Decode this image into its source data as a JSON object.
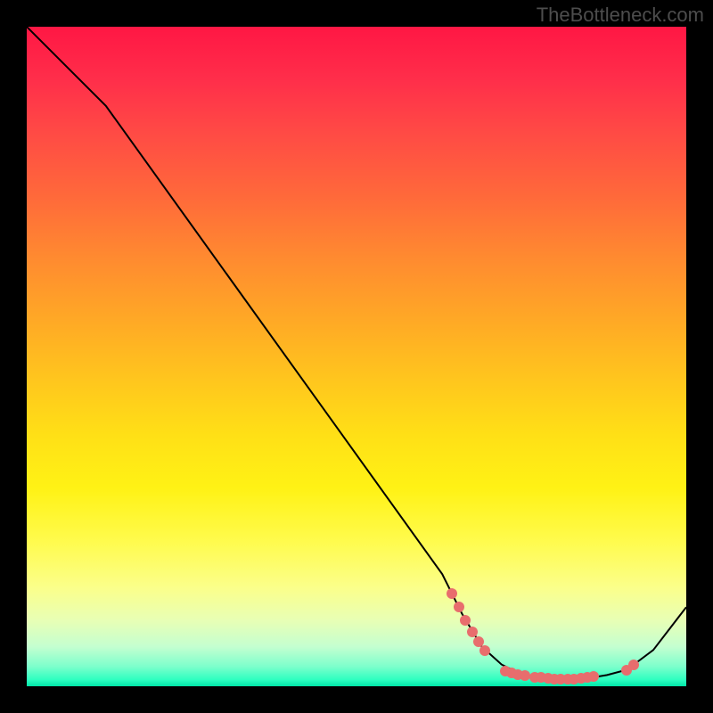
{
  "attribution": "TheBottleneck.com",
  "chart_data": {
    "type": "line",
    "title": "",
    "xlabel": "",
    "ylabel": "",
    "xlim": [
      0,
      100
    ],
    "ylim": [
      0,
      100
    ],
    "curve_points": [
      {
        "x": 0,
        "y": 100
      },
      {
        "x": 7,
        "y": 93
      },
      {
        "x": 12,
        "y": 88
      },
      {
        "x": 63,
        "y": 17
      },
      {
        "x": 66,
        "y": 11
      },
      {
        "x": 69,
        "y": 6
      },
      {
        "x": 72,
        "y": 3.3
      },
      {
        "x": 75,
        "y": 1.8
      },
      {
        "x": 78,
        "y": 1.2
      },
      {
        "x": 82,
        "y": 1.0
      },
      {
        "x": 85,
        "y": 1.2
      },
      {
        "x": 88,
        "y": 1.7
      },
      {
        "x": 91,
        "y": 2.5
      },
      {
        "x": 95,
        "y": 5.5
      },
      {
        "x": 100,
        "y": 12
      }
    ],
    "scatter_points": [
      {
        "x": 64.5,
        "y": 14
      },
      {
        "x": 65.5,
        "y": 12
      },
      {
        "x": 66.5,
        "y": 10
      },
      {
        "x": 67.5,
        "y": 8.2
      },
      {
        "x": 68.5,
        "y": 6.7
      },
      {
        "x": 69.5,
        "y": 5.4
      },
      {
        "x": 72.5,
        "y": 2.3
      },
      {
        "x": 73.5,
        "y": 2.0
      },
      {
        "x": 74.5,
        "y": 1.8
      },
      {
        "x": 75.5,
        "y": 1.6
      },
      {
        "x": 77.0,
        "y": 1.4
      },
      {
        "x": 78.0,
        "y": 1.3
      },
      {
        "x": 79.0,
        "y": 1.2
      },
      {
        "x": 80.0,
        "y": 1.1
      },
      {
        "x": 81.0,
        "y": 1.05
      },
      {
        "x": 82.0,
        "y": 1.05
      },
      {
        "x": 83.0,
        "y": 1.1
      },
      {
        "x": 84.0,
        "y": 1.25
      },
      {
        "x": 85.0,
        "y": 1.4
      },
      {
        "x": 86.0,
        "y": 1.55
      },
      {
        "x": 91.0,
        "y": 2.5
      },
      {
        "x": 92.0,
        "y": 3.2
      }
    ],
    "colors": {
      "curve": "#000000",
      "dots": "#e86d6d"
    }
  }
}
